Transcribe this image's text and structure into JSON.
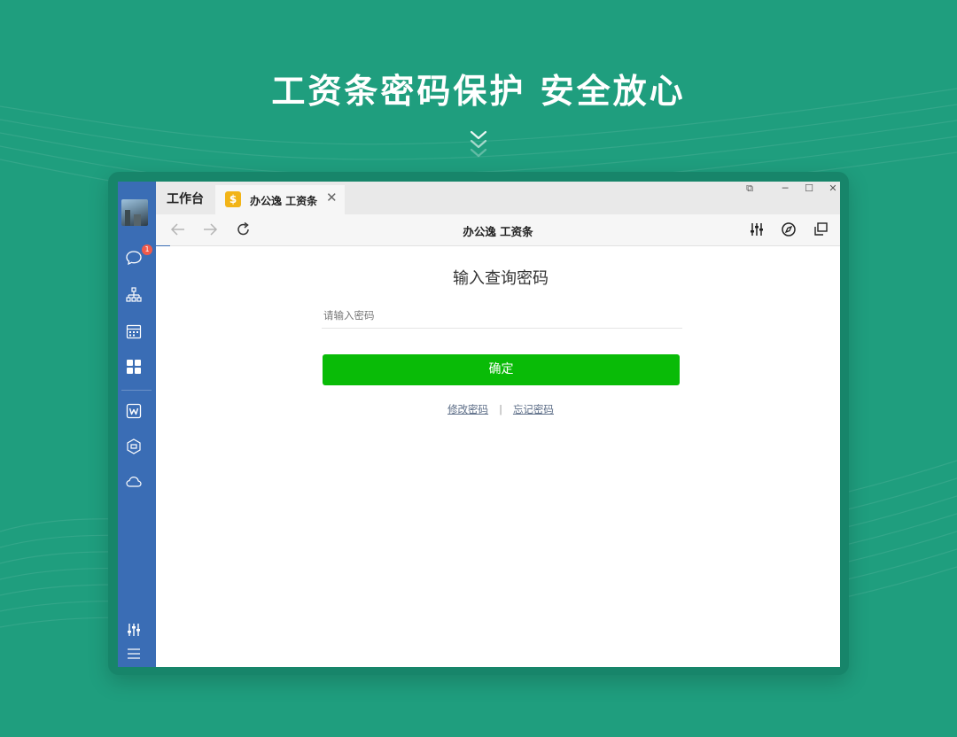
{
  "headline": "工资条密码保护 安全放心",
  "colors": {
    "background": "#1f9e7e",
    "frame": "#17856a",
    "sidebar": "#3a6db5",
    "confirm_button": "#09bb07",
    "badge": "#f05a4a",
    "tab_icon": "#f2b417"
  },
  "sidebar": {
    "avatar": "user-avatar",
    "items": [
      {
        "icon": "chat-icon",
        "badge": "1"
      },
      {
        "icon": "org-chart-icon"
      },
      {
        "icon": "calendar-icon"
      },
      {
        "icon": "workbench-grid-icon",
        "active": true
      },
      {
        "icon": "wps-doc-icon"
      },
      {
        "icon": "cube-icon"
      },
      {
        "icon": "cloud-icon"
      }
    ],
    "bottom": [
      {
        "icon": "settings-sliders-icon"
      },
      {
        "icon": "menu-icon"
      }
    ]
  },
  "tabs": {
    "home_label": "工作台",
    "active_label": "办公逸 工资条",
    "active_icon_glyph": "$",
    "close_glyph": "✕"
  },
  "window_controls": {
    "restore_glyph": "⧉",
    "minimize_glyph": "─",
    "maximize_glyph": "☐",
    "close_glyph": "✕"
  },
  "navbar": {
    "title": "办公逸 工资条",
    "back_icon": "arrow-left-icon",
    "forward_icon": "arrow-right-icon",
    "refresh_icon": "refresh-icon",
    "right_icons": [
      "sliders-icon",
      "compass-icon",
      "new-window-icon"
    ]
  },
  "form": {
    "title": "输入查询密码",
    "password_placeholder": "请输入密码",
    "password_value": "",
    "confirm_label": "确定",
    "change_password_link": "修改密码",
    "separator": "|",
    "forgot_password_link": "忘记密码"
  }
}
